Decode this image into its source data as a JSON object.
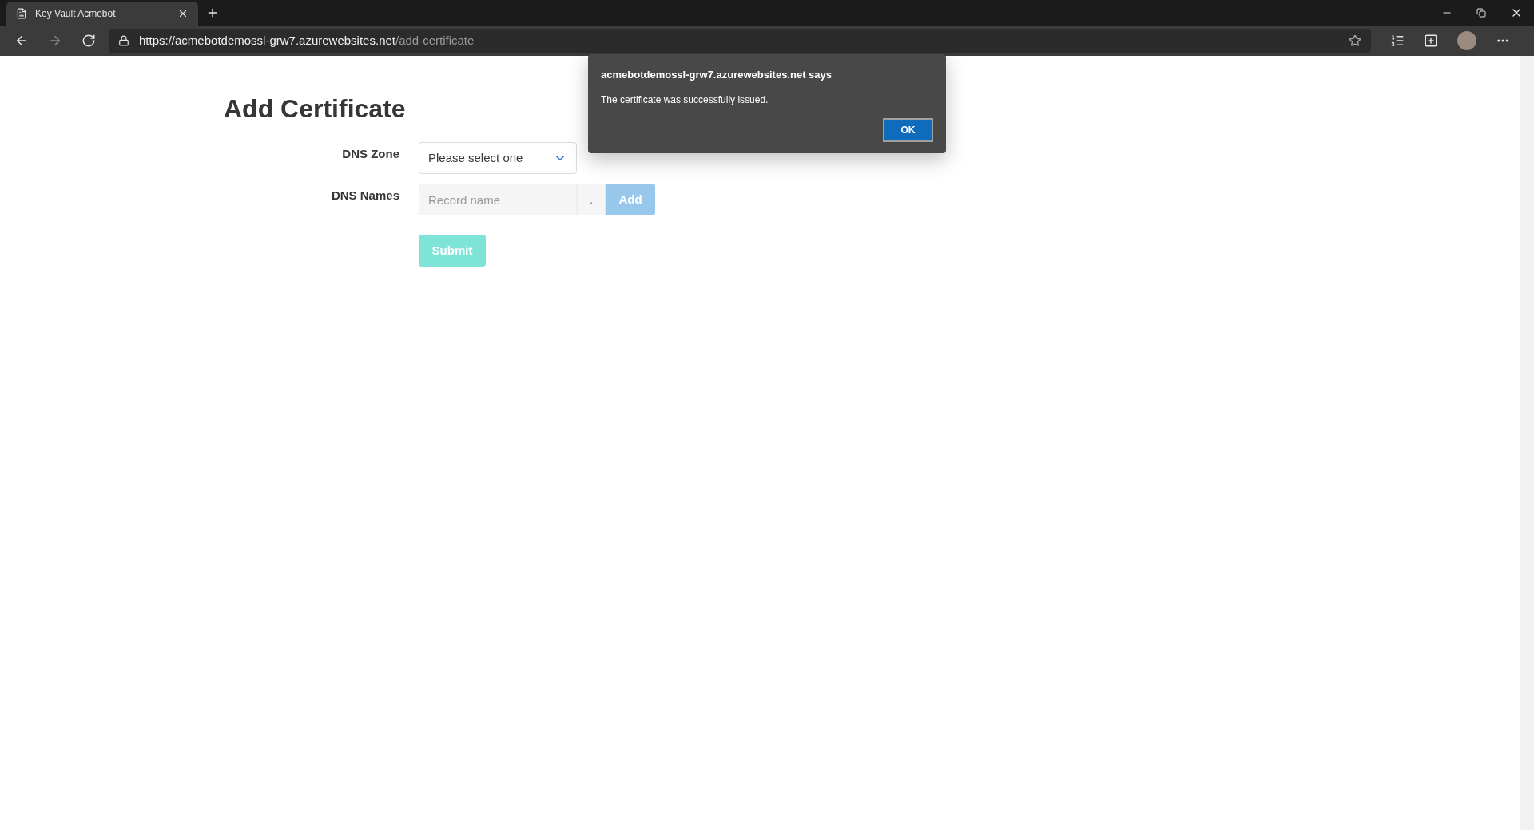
{
  "browser": {
    "tab": {
      "title": "Key Vault Acmebot"
    },
    "url": {
      "host": "https://acmebotdemossl-grw7.azurewebsites.net",
      "path": "/add-certificate"
    }
  },
  "page": {
    "title": "Add Certificate",
    "dns_zone": {
      "label": "DNS Zone",
      "value": "Please select one"
    },
    "dns_names": {
      "label": "DNS Names",
      "placeholder": "Record name",
      "separator": ".",
      "add_button": {
        "label": "Add",
        "disabled": true
      }
    },
    "submit": {
      "label": "Submit",
      "disabled": true
    }
  },
  "dialog": {
    "title": "acmebotdemossl-grw7.azurewebsites.net says",
    "message": "The certificate was successfully issued.",
    "button": "OK"
  }
}
